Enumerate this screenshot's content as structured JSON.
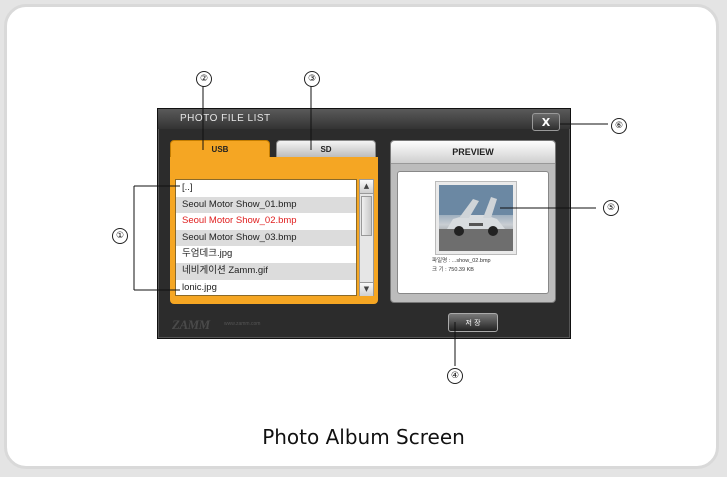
{
  "window": {
    "title": "PHOTO FILE LIST",
    "close_label": "X"
  },
  "tabs": [
    {
      "label": "USB",
      "active": true
    },
    {
      "label": "SD",
      "active": false
    }
  ],
  "files": [
    "[..]",
    "Seoul Motor Show_01.bmp",
    "Seoul Motor Show_02.bmp",
    "Seoul Motor Show_03.bmp",
    "두엄데크.jpg",
    "네비게이션 Zamm.gif",
    "lonic.jpg"
  ],
  "selected_file_index": 2,
  "preview": {
    "header": "PREVIEW",
    "file_info": "파일명 : ...show_02.bmp",
    "size_info": "크 기 : 750.39 KB"
  },
  "brand": {
    "logo": "ZAMM",
    "sub": "www.zamm.com"
  },
  "save_button_label": "저 장",
  "callouts": [
    "①",
    "②",
    "③",
    "④",
    "⑤",
    "⑥"
  ],
  "caption": "Photo Album Screen",
  "colors": {
    "usb_tab": "#f5a623",
    "selected_text": "#e02020",
    "window_bg": "#2c2c2c"
  }
}
